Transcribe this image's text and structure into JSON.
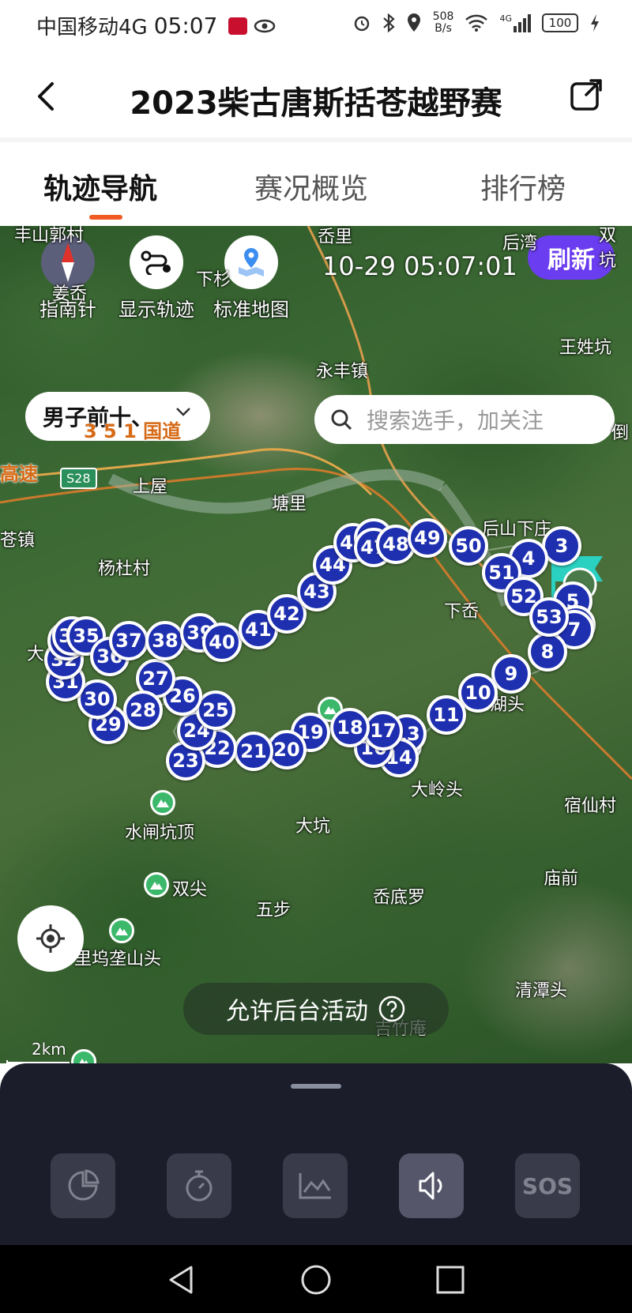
{
  "status_bar": {
    "carrier": "中国移动4G",
    "time": "05:07",
    "net_speed_value": "508",
    "net_speed_unit": "B/s",
    "signal_label": "4G",
    "battery": "100"
  },
  "header": {
    "title": "2023柴古唐斯括苍越野赛"
  },
  "tabs": [
    {
      "label": "轨迹导航",
      "active": true
    },
    {
      "label": "赛况概览",
      "active": false
    },
    {
      "label": "排行榜",
      "active": false
    }
  ],
  "map": {
    "controls": {
      "compass_label": "指南针",
      "show_track_label": "显示轨迹",
      "standard_map_label": "标准地图"
    },
    "timestamp": "10-29 05:07:01",
    "refresh_label": "刷新",
    "filter_selected": "男子前十、",
    "search_placeholder": "搜索选手，加关注",
    "background_activity_label": "允许后台活动",
    "scale_label": "2km",
    "places": [
      "丰山郭村",
      "岙里",
      "后湾",
      "双坑",
      "姜岙",
      "下杉",
      "王姓坑",
      "永丰镇",
      "3 5 1 国道",
      "倒",
      "高速",
      "S28",
      "上屋",
      "塘里",
      "苍镇",
      "后山下庄",
      "杨杜村",
      "下岙",
      "大",
      "湖头",
      "大岭头",
      "宿仙村",
      "水闸坑顶",
      "大坑",
      "庙前",
      "双尖",
      "五步",
      "岙底罗",
      "里坞垄山头",
      "吉竹庵",
      "清潭头"
    ],
    "checkpoints": [
      "2",
      "3",
      "4",
      "5",
      "6",
      "7",
      "8",
      "9",
      "10",
      "11",
      "12",
      "13",
      "14",
      "16",
      "17",
      "18",
      "19",
      "20",
      "21",
      "22",
      "23",
      "24",
      "25",
      "26",
      "27",
      "28",
      "29",
      "30",
      "31",
      "32",
      "33",
      "34",
      "35",
      "36",
      "37",
      "38",
      "39",
      "40",
      "41",
      "42",
      "43",
      "44",
      "45",
      "46",
      "47",
      "48",
      "49",
      "50",
      "51",
      "52",
      "53"
    ]
  },
  "bottom_toolbar": {
    "tools": [
      "pie-chart-icon",
      "stopwatch-icon",
      "elevation-chart-icon",
      "voice-icon",
      "sos-icon"
    ],
    "sos_label": "SOS"
  },
  "colors": {
    "accent": "#f05a23",
    "refresh": "#6b3df0",
    "marker": "#1e2fb0",
    "sheet": "#1c1d2a"
  }
}
